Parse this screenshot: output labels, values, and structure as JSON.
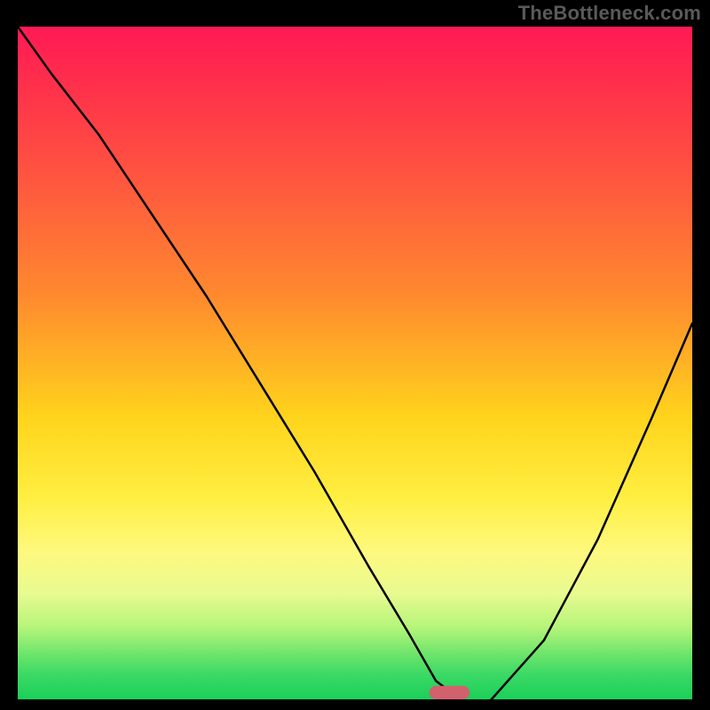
{
  "attribution": "TheBottleneck.com",
  "chart_data": {
    "type": "line",
    "title": "",
    "xlabel": "",
    "ylabel": "",
    "xlim": [
      0,
      100
    ],
    "ylim": [
      0,
      100
    ],
    "series": [
      {
        "name": "curve",
        "x": [
          0,
          5,
          12,
          20,
          28,
          36,
          44,
          52,
          58,
          62,
          66,
          70,
          78,
          86,
          94,
          100
        ],
        "y": [
          100,
          93,
          84,
          72,
          60,
          47,
          34,
          20,
          10,
          3,
          0,
          0,
          9,
          24,
          42,
          56
        ]
      }
    ],
    "marker": {
      "x": 64,
      "y": 0,
      "width": 6,
      "height": 2
    },
    "baseline_y": 0
  }
}
